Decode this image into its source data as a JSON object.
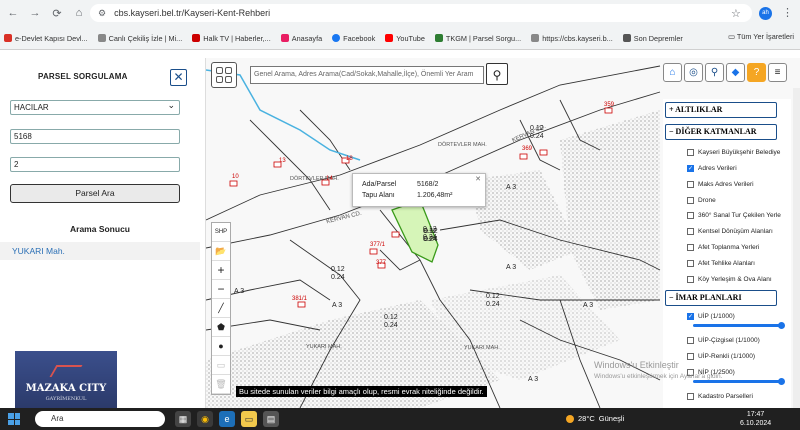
{
  "browser": {
    "url": "cbs.kayseri.bel.tr/Kayseri-Kent-Rehberi",
    "profile": "ah",
    "bookmarks": [
      "e-Devlet Kapısı Devl...",
      "Canlı Çekiliş İzle | Mi...",
      "Halk TV | Haberler,...",
      "Anasayfa",
      "Facebook",
      "YouTube",
      "TKGM | Parsel Sorgu...",
      "https://cbs.kayseri.b...",
      "Son Depremler"
    ],
    "all_bookmarks": "Tüm Yer İşaretleri"
  },
  "panel": {
    "title": "PARSEL SORGULAMA",
    "close": "✕",
    "mahalle": "HACILAR",
    "ada": "5168",
    "parsel": "2",
    "button": "Parsel Ara",
    "result_title": "Arama Sonucu",
    "result_item": "YUKARI Mah."
  },
  "logo": {
    "name": "MAZAKA CITY",
    "sub": "GAYRİMENKUL"
  },
  "map": {
    "search_placeholder": "Genel Arama, Adres Arama(Cad/Sokak,Mahalle,İlçe), Önemli Yer Aram",
    "tools": [
      "SHP",
      "📂",
      "+",
      "−",
      "╱",
      "⬟",
      "●",
      "▭",
      "🗑"
    ],
    "popup": {
      "k1": "Ada/Parsel",
      "v1": "5168/2",
      "k2": "Tapu Alanı",
      "v2": "1.206,48m²"
    },
    "disclaimer": "Bu sitede sunulan veriler bilgi amaçlı olup, resmi evrak niteliğinde değildir.",
    "street": "KERVAN CD.",
    "labels": {
      "p1": "0.12",
      "p1b": "0.24",
      "p2": "0.12",
      "p2b": "0.24",
      "p3": "0.12",
      "p3b": "0.24",
      "p4": "0.12",
      "p4b": "0.24",
      "p5": "0.12",
      "p5b": "0.24",
      "p6": "0.12",
      "p6b": "0.24",
      "n359": "359",
      "n369": "369",
      "n377": "377/1",
      "n377b": "377",
      "n381": "381/1",
      "n10": "10",
      "n13": "13",
      "n14": "14",
      "n18": "18",
      "a3": "A 3",
      "m1": "YUKARI MAH.",
      "m2": "DÖRTEVLER MAH."
    }
  },
  "layers": {
    "toolbar": [
      "⌂",
      "◎",
      "⚲",
      "◆",
      "?",
      "≡"
    ],
    "h1": "+ ALTLIKLAR",
    "h2": "− DİĞER KATMANLAR",
    "items": [
      {
        "label": "Kayseri Büyükşehir Belediye",
        "checked": ""
      },
      {
        "label": "Adres Verileri",
        "checked": "✓"
      },
      {
        "label": "Maks Adres Verileri",
        "checked": ""
      },
      {
        "label": "Drone",
        "checked": ""
      },
      {
        "label": "360° Sanal Tur Çekilen Yerle",
        "checked": ""
      },
      {
        "label": "Kentsel Dönüşüm Alanları",
        "checked": ""
      },
      {
        "label": "Afet Toplanma Yerleri",
        "checked": ""
      },
      {
        "label": "Afet Tehlike Alanları",
        "checked": ""
      },
      {
        "label": "Köy Yerleşim & Ova Alanı",
        "checked": ""
      }
    ],
    "h3": "− İMAR PLANLARI",
    "imar": [
      {
        "label": "UİP (1/1000)",
        "checked": "✓"
      },
      {
        "label": "UİP-Çizgisel (1/1000)",
        "checked": ""
      },
      {
        "label": "UİP-Renkli (1/1000)",
        "checked": ""
      },
      {
        "label": "NİP (1/2500)",
        "checked": ""
      },
      {
        "label": "Kadastro Parselleri",
        "checked": ""
      }
    ]
  },
  "activation": {
    "line1": "Windows'u Etkinleştir",
    "line2": "Windows'u etkinleştirmek için Ayarlar'a gidin."
  },
  "taskbar": {
    "search": "Ara",
    "temp": "28°C",
    "weather": "Güneşli",
    "time": "17:47",
    "date": "6.10.2024"
  }
}
